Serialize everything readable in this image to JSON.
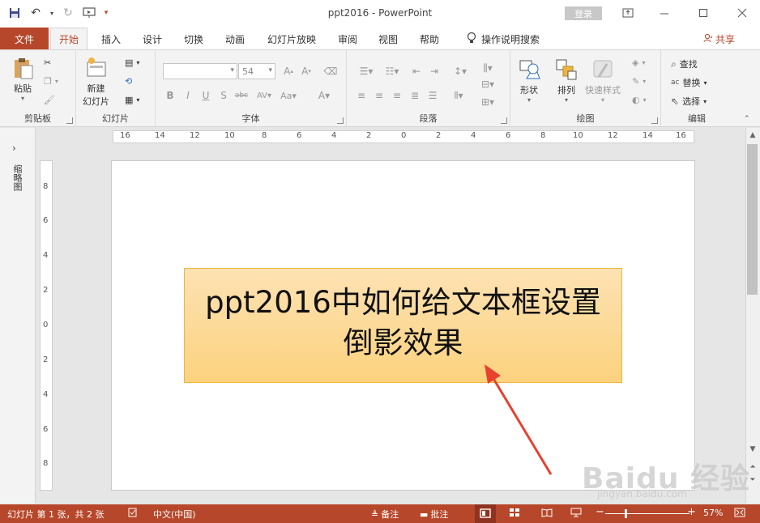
{
  "app": {
    "title": "ppt2016 - PowerPoint",
    "login_label": "登录",
    "share_label": "共享"
  },
  "tabs": [
    "文件",
    "开始",
    "插入",
    "设计",
    "切换",
    "动画",
    "幻灯片放映",
    "审阅",
    "视图",
    "帮助"
  ],
  "search_hint": "操作说明搜索",
  "ribbon": {
    "clipboard": {
      "label": "剪贴板",
      "paste": "粘贴"
    },
    "slides": {
      "label": "幻灯片",
      "new_slide_line1": "新建",
      "new_slide_line2": "幻灯片"
    },
    "font": {
      "label": "字体",
      "font_size": "54"
    },
    "paragraph": {
      "label": "段落"
    },
    "drawing": {
      "label": "绘图",
      "shapes": "形状",
      "arrange": "排列",
      "quick_styles": "快速样式"
    },
    "editing": {
      "label": "编辑",
      "find": "查找",
      "replace": "替换",
      "select": "选择"
    }
  },
  "thumbnail_pane_label": "缩略图",
  "ruler": {
    "horizontal": [
      "16",
      "14",
      "12",
      "10",
      "8",
      "6",
      "4",
      "2",
      "0",
      "2",
      "4",
      "6",
      "8",
      "10",
      "12",
      "14",
      "16"
    ],
    "vertical": [
      "8",
      "6",
      "4",
      "2",
      "0",
      "2",
      "4",
      "6",
      "8"
    ]
  },
  "slide": {
    "text_line1": "ppt2016中如何给文本框设置",
    "text_line2": "倒影效果"
  },
  "status": {
    "slide_info": "幻灯片 第 1 张，共 2 张",
    "language": "中文(中国)",
    "notes": "备注",
    "comments": "批注",
    "zoom": "57%"
  },
  "watermark": {
    "main": "Baidu 经验",
    "sub": "jingyan.baidu.com"
  },
  "colors": {
    "accent": "#b7472a",
    "textbox_fill": "#fbd27e",
    "arrow": "#e8412f"
  }
}
